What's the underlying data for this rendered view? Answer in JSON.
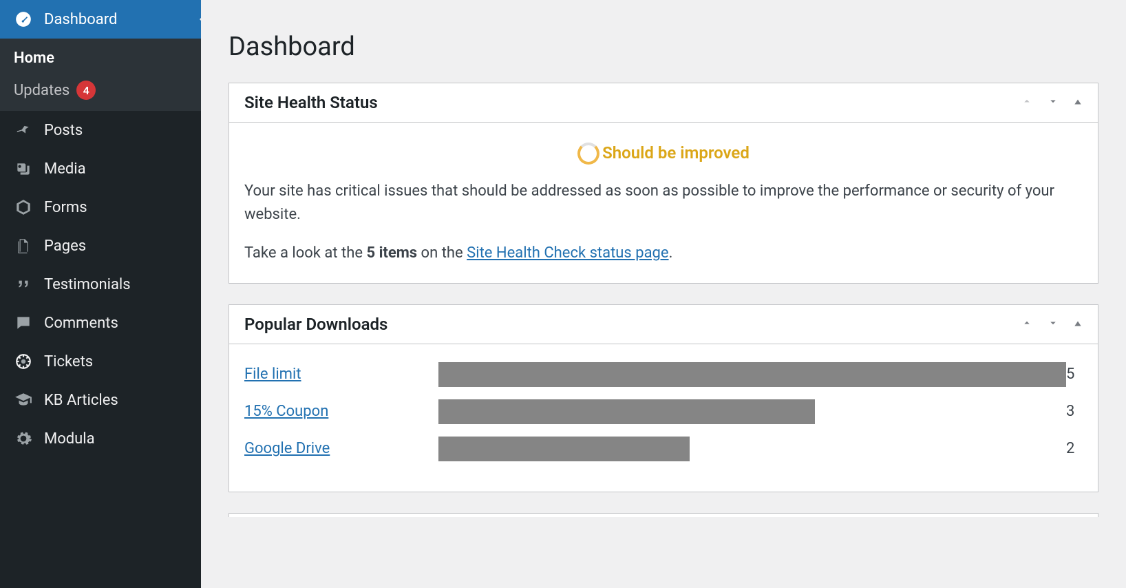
{
  "page": {
    "title": "Dashboard"
  },
  "sidebar": {
    "active": {
      "label": "Dashboard"
    },
    "sub": [
      {
        "label": "Home",
        "current": true
      },
      {
        "label": "Updates",
        "badge": "4"
      }
    ],
    "items": [
      {
        "label": "Posts"
      },
      {
        "label": "Media"
      },
      {
        "label": "Forms"
      },
      {
        "label": "Pages"
      },
      {
        "label": "Testimonials"
      },
      {
        "label": "Comments"
      },
      {
        "label": "Tickets"
      },
      {
        "label": "KB Articles"
      },
      {
        "label": "Modula"
      }
    ]
  },
  "site_health": {
    "title": "Site Health Status",
    "status_label": "Should be improved",
    "description": "Your site has critical issues that should be addressed as soon as possible to improve the performance or security of your website.",
    "items_prefix": "Take a look at the ",
    "items_count": "5 items",
    "items_mid": " on the ",
    "items_link": "Site Health Check status page",
    "items_suffix": "."
  },
  "downloads": {
    "title": "Popular Downloads",
    "max": 5,
    "rows": [
      {
        "label": "File limit",
        "count": 5
      },
      {
        "label": "15% Coupon",
        "count": 3
      },
      {
        "label": "Google Drive",
        "count": 2
      }
    ]
  },
  "chart_data": {
    "type": "bar",
    "title": "Popular Downloads",
    "categories": [
      "File limit",
      "15% Coupon",
      "Google Drive"
    ],
    "values": [
      5,
      3,
      2
    ],
    "xlabel": "",
    "ylabel": "",
    "ylim": [
      0,
      5
    ]
  }
}
